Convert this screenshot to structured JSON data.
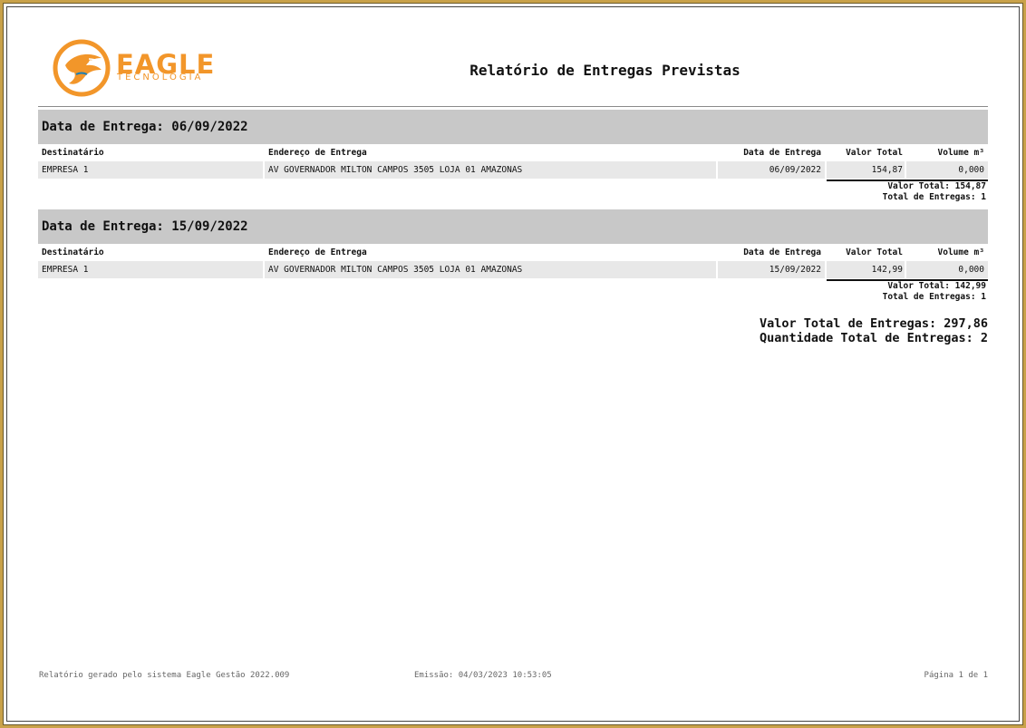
{
  "logo": {
    "word": "EAGLE",
    "sub": "TECNOLOGIA"
  },
  "report": {
    "title": "Relatório de Entregas Previstas"
  },
  "columns": {
    "destinatario": "Destinatário",
    "endereco": "Endereço de Entrega",
    "data": "Data de Entrega",
    "valor": "Valor Total",
    "volume": "Volume m³"
  },
  "groups": [
    {
      "header": "Data de Entrega: 06/09/2022",
      "rows": [
        {
          "destinatario": "EMPRESA 1",
          "endereco": "AV GOVERNADOR MILTON CAMPOS 3505 LOJA 01 AMAZONAS",
          "data": "06/09/2022",
          "valor": "154,87",
          "volume": "0,000"
        }
      ],
      "subtotal_valor": "Valor Total: 154,87",
      "subtotal_qtd": "Total de Entregas: 1"
    },
    {
      "header": "Data de Entrega: 15/09/2022",
      "rows": [
        {
          "destinatario": "EMPRESA 1",
          "endereco": "AV GOVERNADOR MILTON CAMPOS 3505 LOJA 01 AMAZONAS",
          "data": "15/09/2022",
          "valor": "142,99",
          "volume": "0,000"
        }
      ],
      "subtotal_valor": "Valor Total: 142,99",
      "subtotal_qtd": "Total de Entregas: 1"
    }
  ],
  "grand_total": {
    "valor": "Valor Total de Entregas: 297,86",
    "quantidade": "Quantidade Total de Entregas: 2"
  },
  "footer": {
    "system": "Relatório gerado pelo sistema Eagle Gestão 2022.009",
    "emissao": "Emissão: 04/03/2023  10:53:05",
    "pagina": "Página 1 de 1"
  },
  "colors": {
    "brand_orange": "#f2962a",
    "group_header_bg": "#c8c8c8",
    "row_bg": "#e8e8e8",
    "frame_gold": "#c9a24a"
  }
}
